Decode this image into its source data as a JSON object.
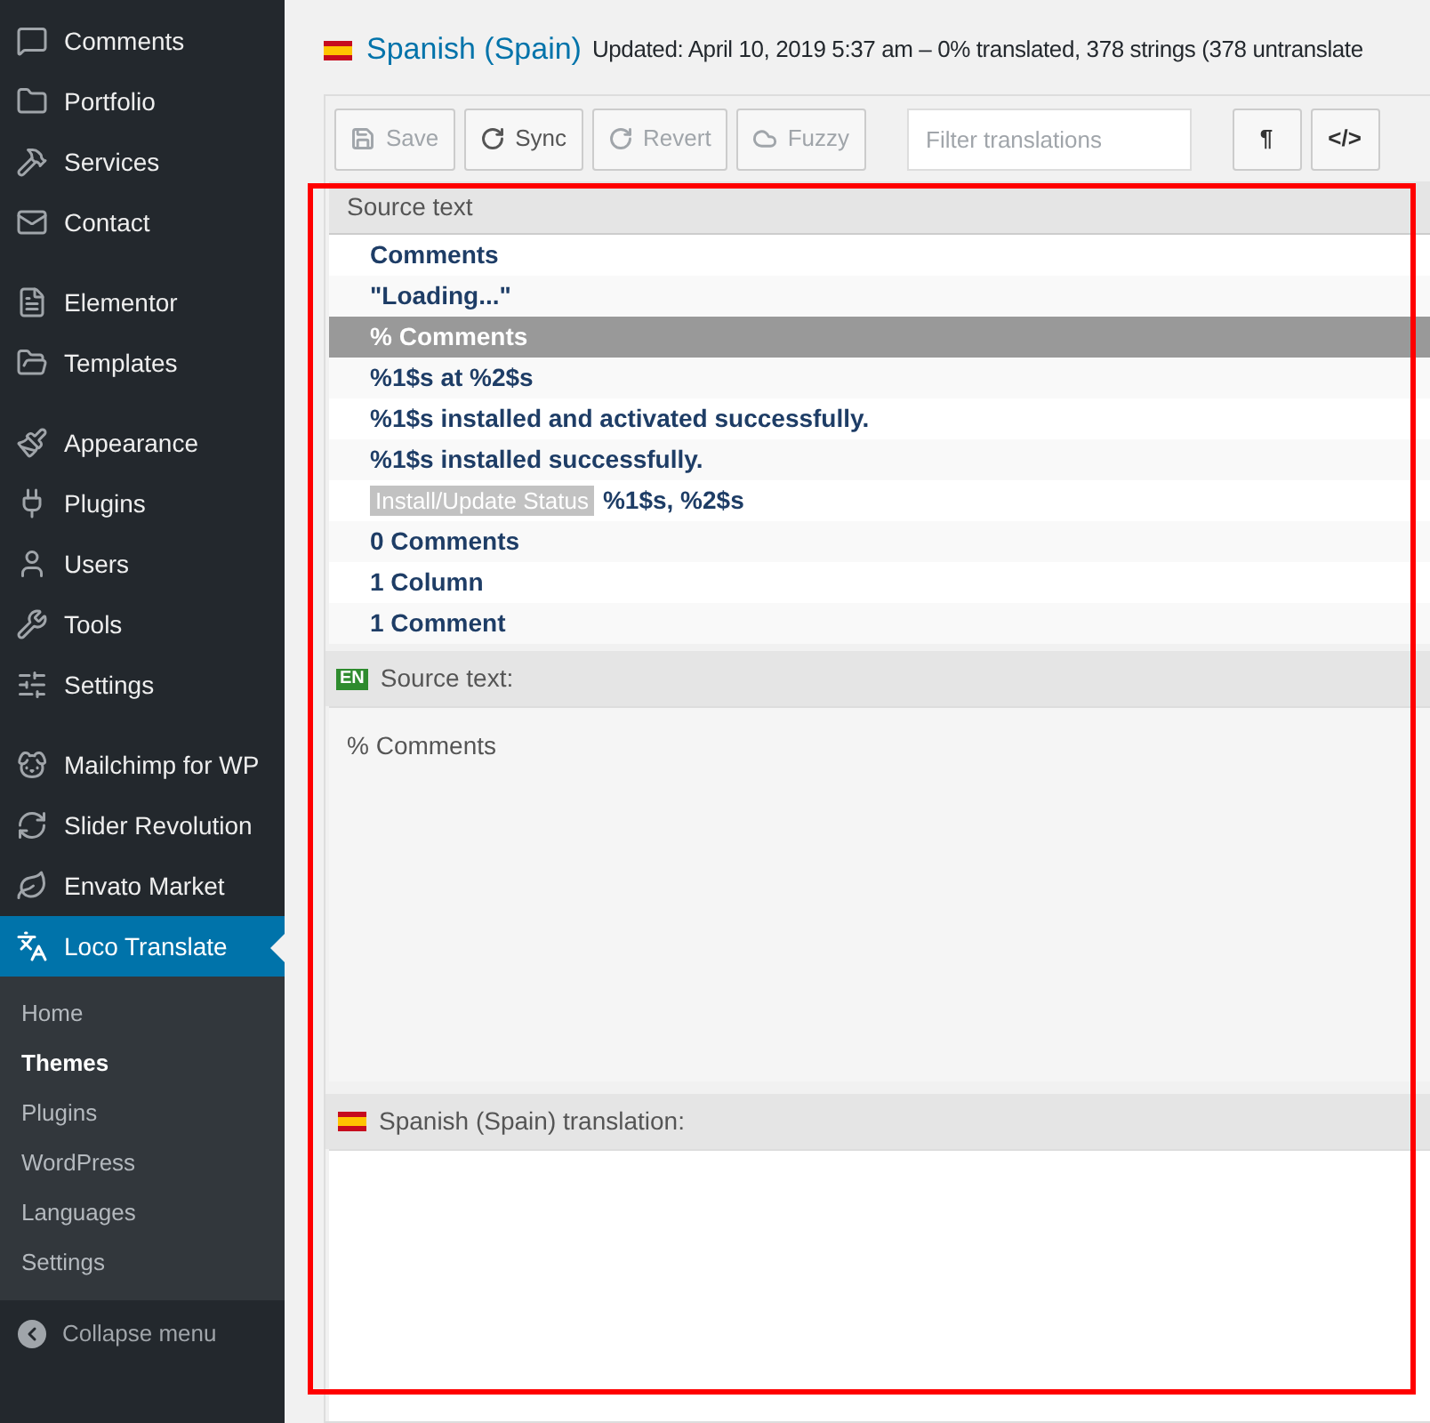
{
  "sidebar": {
    "groups": [
      [
        {
          "label": "Comments",
          "selected": false
        },
        {
          "label": "Portfolio",
          "selected": false
        },
        {
          "label": "Services",
          "selected": false
        },
        {
          "label": "Contact",
          "selected": false
        }
      ],
      [
        {
          "label": "Elementor",
          "selected": false
        },
        {
          "label": "Templates",
          "selected": false
        }
      ],
      [
        {
          "label": "Appearance",
          "selected": false
        },
        {
          "label": "Plugins",
          "selected": false
        },
        {
          "label": "Users",
          "selected": false
        },
        {
          "label": "Tools",
          "selected": false
        },
        {
          "label": "Settings",
          "selected": false
        }
      ],
      [
        {
          "label": "Mailchimp for WP",
          "selected": false
        },
        {
          "label": "Slider Revolution",
          "selected": false
        },
        {
          "label": "Envato Market",
          "selected": false
        },
        {
          "label": "Loco Translate",
          "selected": true
        }
      ]
    ],
    "submenu": [
      {
        "label": "Home",
        "selected": false
      },
      {
        "label": "Themes",
        "selected": true
      },
      {
        "label": "Plugins",
        "selected": false
      },
      {
        "label": "WordPress",
        "selected": false
      },
      {
        "label": "Languages",
        "selected": false
      },
      {
        "label": "Settings",
        "selected": false
      }
    ],
    "collapse": "Collapse menu"
  },
  "header": {
    "language": "Spanish (Spain)",
    "meta": "Updated: April 10, 2019 5:37 am – 0% translated, 378 strings (378 untranslate"
  },
  "toolbar": {
    "buttons": [
      {
        "label": "Save",
        "disabled": true
      },
      {
        "label": "Sync",
        "disabled": false
      },
      {
        "label": "Revert",
        "disabled": true
      },
      {
        "label": "Fuzzy",
        "disabled": true
      }
    ],
    "filter": {
      "placeholder": "Filter translations"
    },
    "toggles": [
      "¶",
      "</>"
    ]
  },
  "list": {
    "heading": "Source text",
    "rows": [
      {
        "text": "Comments",
        "selected": false
      },
      {
        "text": "\"Loading...\"",
        "selected": false
      },
      {
        "text": "% Comments",
        "selected": true
      },
      {
        "text": "%1$s at %2$s",
        "selected": false
      },
      {
        "text": "%1$s installed and activated successfully.",
        "selected": false
      },
      {
        "text": "%1$s installed successfully.",
        "selected": false
      },
      {
        "context": "Install/Update Status",
        "text": "%1$s, %2$s",
        "selected": false
      },
      {
        "text": "0 Comments",
        "selected": false
      },
      {
        "text": "1 Column",
        "selected": false
      },
      {
        "text": "1 Comment",
        "selected": false
      }
    ]
  },
  "source": {
    "badge": "EN",
    "label": "Source text:",
    "value": "% Comments"
  },
  "translation": {
    "label": "Spanish (Spain) translation:"
  }
}
